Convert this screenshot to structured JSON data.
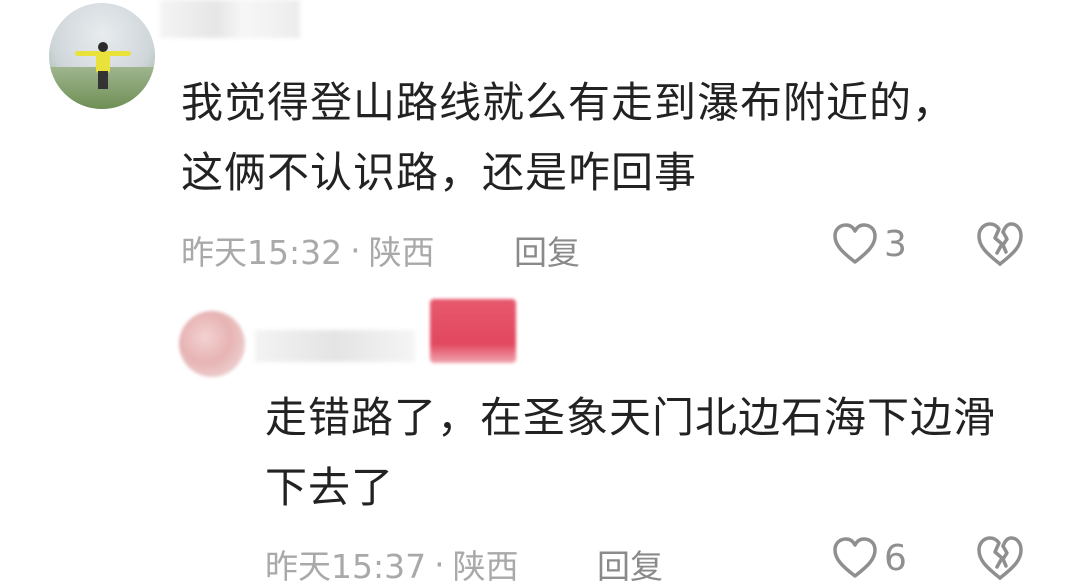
{
  "comments": [
    {
      "text_line1": "我觉得登山路线就么有走到瀑布附近的，",
      "text_line2": "这俩不认识路，还是咋回事",
      "time": "昨天15:32",
      "separator": "·",
      "location": "陕西",
      "reply_label": "回复",
      "like_count": "3",
      "like_icon": "heart-outline-icon",
      "dislike_icon": "broken-heart-icon"
    },
    {
      "text_line1": "走错路了，在圣象天门北边石海下边滑",
      "text_line2": "下去了",
      "time": "昨天15:37",
      "separator": "·",
      "location": "陕西",
      "reply_label": "回复",
      "like_count": "6",
      "like_icon": "heart-outline-icon",
      "dislike_icon": "broken-heart-icon"
    }
  ],
  "colors": {
    "text": "#222222",
    "meta": "#a9a9a9",
    "icon": "#8f8f8f",
    "badge": "#e2485f"
  }
}
